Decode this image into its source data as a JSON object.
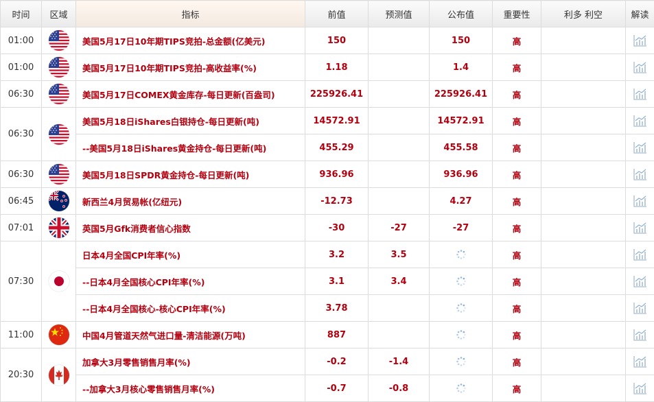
{
  "headers": {
    "time": "时间",
    "region": "区域",
    "indicator": "指标",
    "previous": "前值",
    "forecast": "预测值",
    "actual": "公布值",
    "importance": "重要性",
    "bull_bear": "利多 利空",
    "analysis": "解读"
  },
  "groups": [
    {
      "time": "01:00",
      "flag": "us-flag-icon",
      "rows": [
        {
          "indicator": "美国5月17日10年期TIPS竞拍-总金额(亿美元)",
          "previous": "150",
          "forecast": "",
          "actual": "150",
          "importance": "高"
        }
      ]
    },
    {
      "time": "01:00",
      "flag": "us-flag-icon",
      "rows": [
        {
          "indicator": "美国5月17日10年期TIPS竞拍-高收益率(%)",
          "previous": "1.18",
          "forecast": "",
          "actual": "1.4",
          "importance": "高"
        }
      ]
    },
    {
      "time": "06:30",
      "flag": "us-flag-icon",
      "rows": [
        {
          "indicator": "美国5月17日COMEX黄金库存-每日更新(百盎司)",
          "previous": "225926.41",
          "forecast": "",
          "actual": "225926.41",
          "importance": "高"
        }
      ]
    },
    {
      "time": "06:30",
      "flag": "us-flag-icon",
      "rows": [
        {
          "indicator": "美国5月18日iShares白银持仓-每日更新(吨)",
          "previous": "14572.91",
          "forecast": "",
          "actual": "14572.91",
          "importance": "高"
        },
        {
          "indicator": "--美国5月18日iShares黄金持仓-每日更新(吨)",
          "previous": "455.29",
          "forecast": "",
          "actual": "455.58",
          "importance": "高"
        }
      ]
    },
    {
      "time": "06:30",
      "flag": "us-flag-icon",
      "rows": [
        {
          "indicator": "美国5月18日SPDR黄金持仓-每日更新(吨)",
          "previous": "936.96",
          "forecast": "",
          "actual": "936.96",
          "importance": "高"
        }
      ]
    },
    {
      "time": "06:45",
      "flag": "nz-flag-icon",
      "rows": [
        {
          "indicator": "新西兰4月贸易帐(亿纽元)",
          "previous": "-12.73",
          "forecast": "",
          "actual": "4.27",
          "importance": "高"
        }
      ]
    },
    {
      "time": "07:01",
      "flag": "uk-flag-icon",
      "rows": [
        {
          "indicator": "英国5月Gfk消费者信心指数",
          "previous": "-30",
          "forecast": "-27",
          "actual": "-27",
          "importance": "高"
        }
      ]
    },
    {
      "time": "07:30",
      "flag": "jp-flag-icon",
      "sep": true,
      "rows": [
        {
          "indicator": "日本4月全国CPI年率(%)",
          "previous": "3.2",
          "forecast": "3.5",
          "actual": "",
          "importance": "高"
        },
        {
          "indicator": "--日本4月全国核心CPI年率(%)",
          "previous": "3.1",
          "forecast": "3.4",
          "actual": "",
          "importance": "高"
        },
        {
          "indicator": "--日本4月全国核心-核心CPI年率(%)",
          "previous": "3.78",
          "forecast": "",
          "actual": "",
          "importance": "高"
        }
      ]
    },
    {
      "time": "11:00",
      "flag": "cn-flag-icon",
      "rows": [
        {
          "indicator": "中国4月管道天然气进口量-清洁能源(万吨)",
          "previous": "887",
          "forecast": "",
          "actual": "",
          "importance": "高"
        }
      ]
    },
    {
      "time": "20:30",
      "flag": "ca-flag-icon",
      "rows": [
        {
          "indicator": "加拿大3月零售销售月率(%)",
          "previous": "-0.2",
          "forecast": "-1.4",
          "actual": "",
          "importance": "高"
        },
        {
          "indicator": "--加拿大3月核心零售销售月率(%)",
          "previous": "-0.7",
          "forecast": "-0.8",
          "actual": "",
          "importance": "高"
        }
      ]
    }
  ],
  "colors": {
    "text_red": "#b3000f",
    "separator": "#c43a2a",
    "border": "#dcdcdc"
  }
}
